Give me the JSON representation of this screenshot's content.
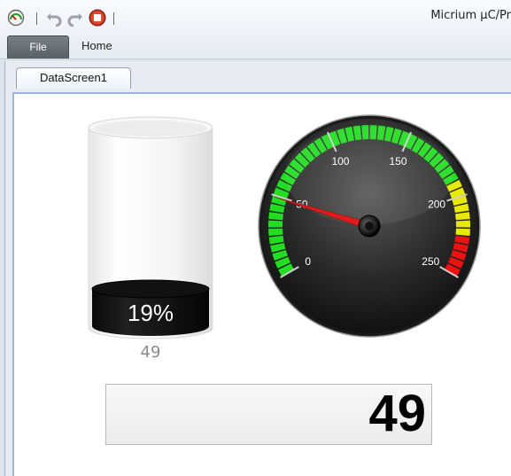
{
  "app": {
    "title": "Micrium µC/Pr"
  },
  "quick_access": {
    "icons": [
      "gauge-app-icon",
      "undo-icon",
      "redo-icon",
      "stop-icon"
    ]
  },
  "ribbon": {
    "file_label": "File",
    "home_label": "Home"
  },
  "document": {
    "tab_label": "DataScreen1"
  },
  "tank": {
    "percent_label": "19%",
    "value_label": "49",
    "fill_fraction": 0.19
  },
  "gauge": {
    "min": 0,
    "max": 250,
    "value": 49,
    "tick_labels": [
      "0",
      "50",
      "100",
      "150",
      "200",
      "250"
    ],
    "colors": {
      "green": "#22dd22",
      "yellow": "#e8e800",
      "red": "#ee1111",
      "needle": "#e01b1b"
    }
  },
  "numeric_display": {
    "value": "49"
  }
}
